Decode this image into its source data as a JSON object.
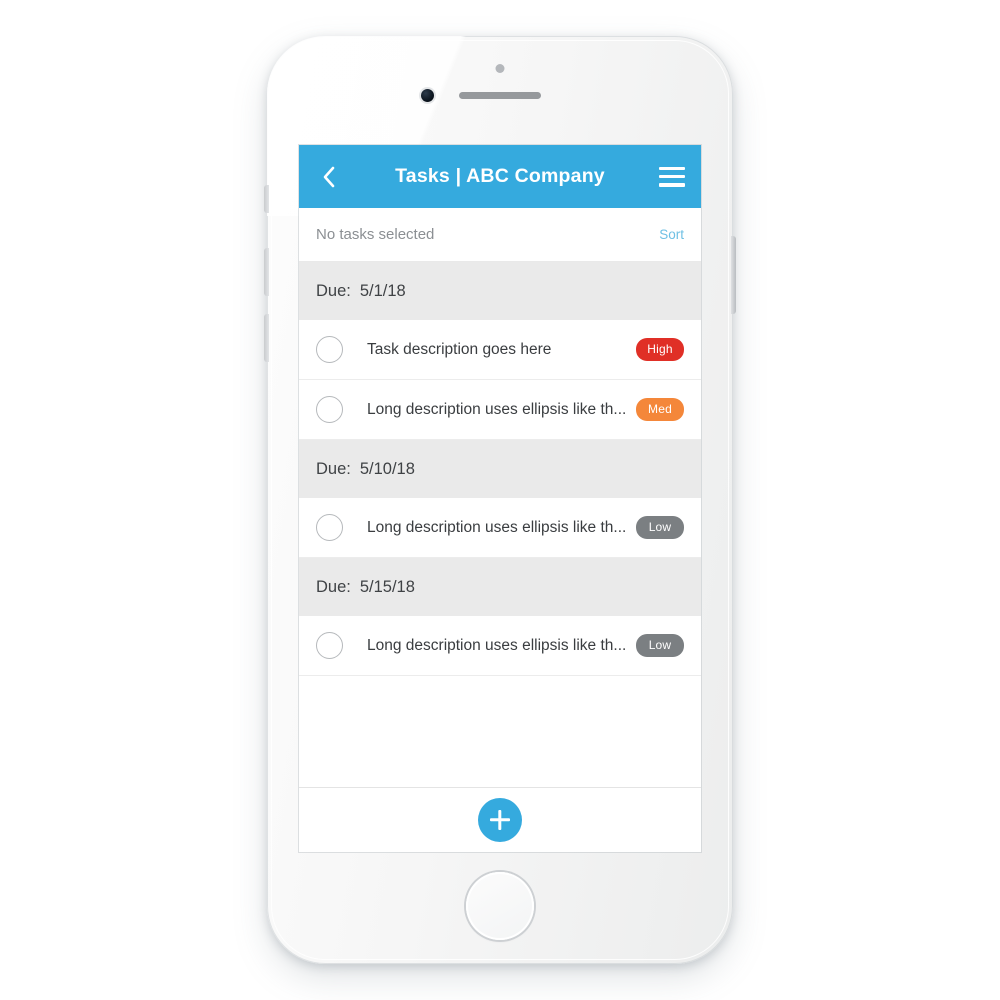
{
  "device": {
    "type": "smartphone",
    "icons": {
      "front_camera": "camera-icon",
      "speaker": "speaker-grille-icon",
      "sensor": "proximity-sensor-icon",
      "home_button": "home-button-icon"
    }
  },
  "header": {
    "back_icon": "chevron-left-icon",
    "title": "Tasks  |  ABC Company",
    "menu_icon": "hamburger-menu-icon",
    "background_color": "#35aade"
  },
  "subbar": {
    "status_text": "No tasks selected",
    "sort_label": "Sort",
    "sort_color": "#6fc0e4"
  },
  "groups": [
    {
      "due_label": "Due:",
      "due_date": "5/1/18",
      "tasks": [
        {
          "description": "Task description goes here",
          "priority": "High",
          "priority_color": "#e02f26",
          "checked": false
        },
        {
          "description": "Long description uses ellipsis like th...",
          "priority": "Med",
          "priority_color": "#f4873a",
          "checked": false
        }
      ]
    },
    {
      "due_label": "Due:",
      "due_date": "5/10/18",
      "tasks": [
        {
          "description": "Long description uses ellipsis like th...",
          "priority": "Low",
          "priority_color": "#7b7f82",
          "checked": false
        }
      ]
    },
    {
      "due_label": "Due:",
      "due_date": "5/15/18",
      "tasks": [
        {
          "description": "Long description uses ellipsis like th...",
          "priority": "Low",
          "priority_color": "#7b7f82",
          "checked": false
        }
      ]
    }
  ],
  "bottom_bar": {
    "add_icon": "plus-icon",
    "add_color": "#35aade"
  }
}
